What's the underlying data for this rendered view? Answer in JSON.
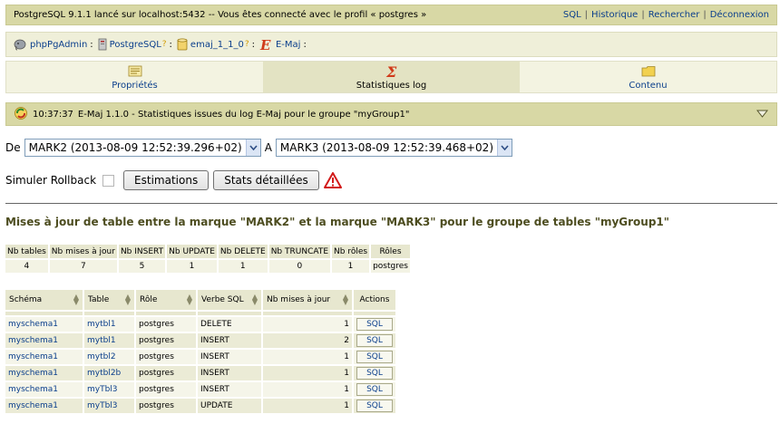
{
  "topbar": {
    "info": "PostgreSQL 9.1.1 lancé sur localhost:5432 -- Vous êtes connecté avec le profil « postgres »",
    "links": [
      "SQL",
      "Historique",
      "Rechercher",
      "Déconnexion"
    ]
  },
  "breadcrumb": {
    "items": [
      {
        "label": "phpPgAdmin",
        "icon": "elephant-icon",
        "qmark": ""
      },
      {
        "label": "PostgreSQL",
        "icon": "server-icon",
        "qmark": "?"
      },
      {
        "label": "emaj_1_1_0",
        "icon": "database-icon",
        "qmark": "?"
      },
      {
        "label": "E-Maj",
        "icon": "emaj-logo-icon",
        "qmark": ""
      }
    ]
  },
  "tabs": [
    {
      "label": "Propriétés",
      "icon": "properties-icon",
      "active": false
    },
    {
      "label": "Statistiques log",
      "icon": "sigma-icon",
      "active": true
    },
    {
      "label": "Contenu",
      "icon": "folder-icon",
      "active": false
    }
  ],
  "section": {
    "time": "10:37:37",
    "text": "E-Maj 1.1.0  -  Statistiques issues du log E-Maj pour le groupe \"myGroup1\""
  },
  "marks": {
    "from_label": "De",
    "from_value": "MARK2 (2013-08-09 12:52:39.296+02)",
    "to_label": "A",
    "to_value": "MARK3 (2013-08-09 12:52:39.468+02)"
  },
  "controls": {
    "simulate_label": "Simuler Rollback",
    "estimate_button": "Estimations",
    "detailed_button": "Stats détaillées"
  },
  "title": "Mises à jour de table entre la marque \"MARK2\" et la marque \"MARK3\" pour le groupe de tables \"myGroup1\"",
  "summary": {
    "headers": [
      "Nb tables",
      "Nb mises à jour",
      "Nb INSERT",
      "Nb UPDATE",
      "Nb DELETE",
      "Nb TRUNCATE",
      "Nb rôles",
      "Rôles"
    ],
    "values": [
      "4",
      "7",
      "5",
      "1",
      "1",
      "0",
      "1",
      "postgres"
    ]
  },
  "detail": {
    "headers": [
      "Schéma",
      "Table",
      "Rôle",
      "Verbe SQL",
      "Nb mises à jour",
      "Actions"
    ],
    "rows": [
      {
        "schema": "myschema1",
        "table": "mytbl1",
        "role": "postgres",
        "verb": "DELETE",
        "count": "1",
        "action": "SQL"
      },
      {
        "schema": "myschema1",
        "table": "mytbl1",
        "role": "postgres",
        "verb": "INSERT",
        "count": "2",
        "action": "SQL"
      },
      {
        "schema": "myschema1",
        "table": "mytbl2",
        "role": "postgres",
        "verb": "INSERT",
        "count": "1",
        "action": "SQL"
      },
      {
        "schema": "myschema1",
        "table": "mytbl2b",
        "role": "postgres",
        "verb": "INSERT",
        "count": "1",
        "action": "SQL"
      },
      {
        "schema": "myschema1",
        "table": "myTbl3",
        "role": "postgres",
        "verb": "INSERT",
        "count": "1",
        "action": "SQL"
      },
      {
        "schema": "myschema1",
        "table": "myTbl3",
        "role": "postgres",
        "verb": "UPDATE",
        "count": "1",
        "action": "SQL"
      }
    ]
  },
  "colors": {
    "header_bar": "#d8d8a5",
    "link": "#0b3f8c",
    "title": "#4d4d20"
  }
}
